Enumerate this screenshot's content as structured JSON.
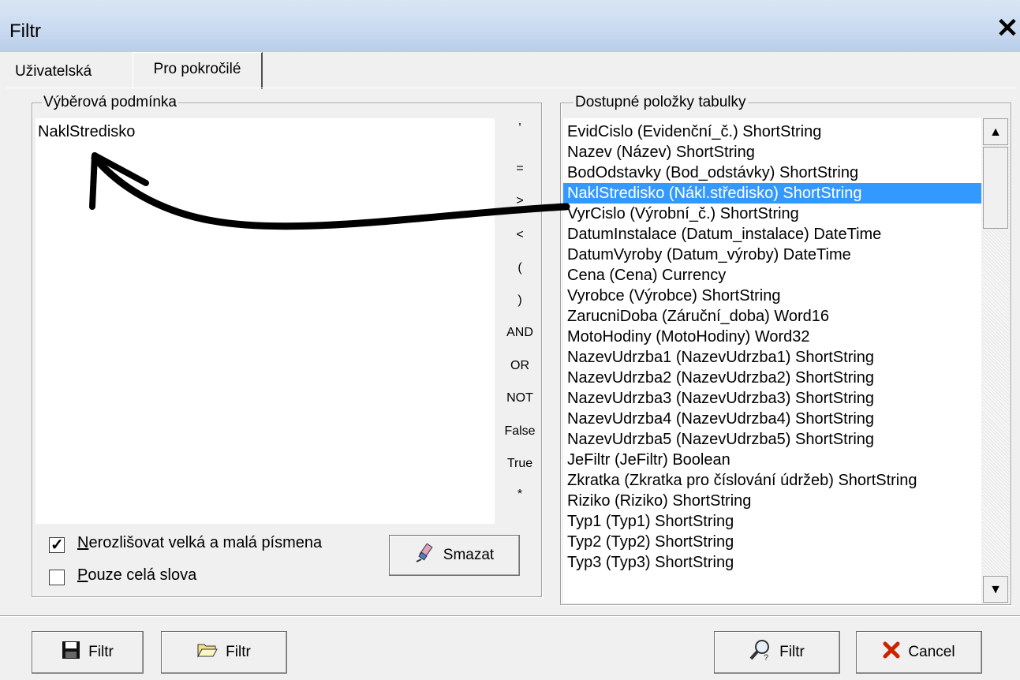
{
  "window": {
    "title": "Filtr",
    "close_label": "✕"
  },
  "tabs": [
    {
      "label": "Uživatelská"
    },
    {
      "label": "Pro pokročilé"
    }
  ],
  "condition_group": {
    "label": "Výběrová podmínka",
    "value": "NaklStredisko",
    "operators": [
      "'",
      "=",
      ">",
      "<",
      "(",
      ")",
      "AND",
      "OR",
      "NOT",
      "False",
      "True",
      "*"
    ],
    "case_insensitive": {
      "label": "Nerozlišovat velká a malá písmena",
      "checked": true
    },
    "whole_words": {
      "label": "Pouze celá slova",
      "checked": false
    },
    "clear_button": "Smazat"
  },
  "fields_group": {
    "label": "Dostupné položky tabulky",
    "selected_index": 3,
    "items": [
      "EvidCislo  (Evidenční_č.)  ShortString",
      "Nazev  (Název)  ShortString",
      "BodOdstavky  (Bod_odstávky)  ShortString",
      "NaklStredisko  (Nákl.středisko)  ShortString",
      "VyrCislo  (Výrobní_č.)  ShortString",
      "DatumInstalace  (Datum_instalace)  DateTime",
      "DatumVyroby  (Datum_výroby)  DateTime",
      "Cena  (Cena)  Currency",
      "Vyrobce  (Výrobce)  ShortString",
      "ZarucniDoba  (Záruční_doba)  Word16",
      "MotoHodiny  (MotoHodiny)  Word32",
      "NazevUdrzba1  (NazevUdrzba1)  ShortString",
      "NazevUdrzba2  (NazevUdrzba2)  ShortString",
      "NazevUdrzba3  (NazevUdrzba3)  ShortString",
      "NazevUdrzba4  (NazevUdrzba4)  ShortString",
      "NazevUdrzba5  (NazevUdrzba5)  ShortString",
      "JeFiltr  (JeFiltr)  Boolean",
      "Zkratka  (Zkratka pro číslování údržeb)  ShortString",
      "Riziko  (Riziko)  ShortString",
      "Typ1  (Typ1)  ShortString",
      "Typ2  (Typ2)  ShortString",
      "Typ3  (Typ3)  ShortString"
    ]
  },
  "footer": {
    "save_label": "Filtr",
    "open_label": "Filtr",
    "apply_label": "Filtr",
    "cancel_label": "Cancel"
  },
  "colors": {
    "selection": "#3399ff",
    "cancel_icon": "#cc2200"
  }
}
